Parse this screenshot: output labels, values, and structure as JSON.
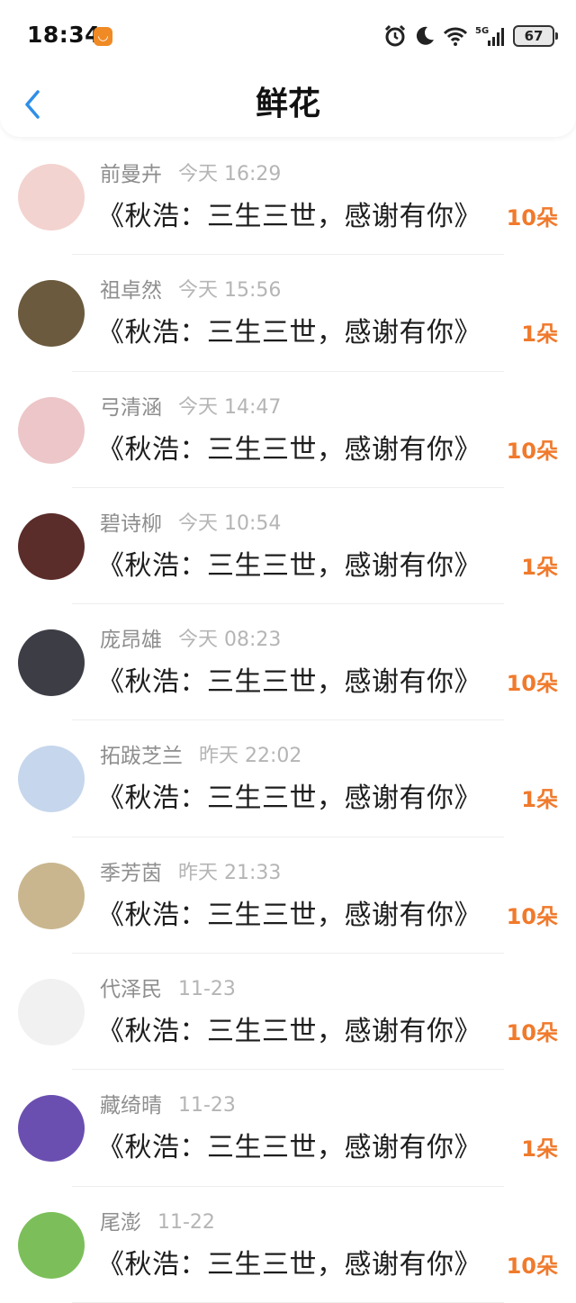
{
  "status_bar": {
    "time": "18:34",
    "battery": "67"
  },
  "header": {
    "title": "鲜花"
  },
  "items": [
    {
      "name": "前曼卉",
      "time": "今天 16:29",
      "gift": "《秋浩：三生三世，感谢有你》",
      "count": "10朵",
      "avatar_color": "#f3d3cf"
    },
    {
      "name": "祖卓然",
      "time": "今天 15:56",
      "gift": "《秋浩：三生三世，感谢有你》",
      "count": "1朵",
      "avatar_color": "#6b5a3e"
    },
    {
      "name": "弓清涵",
      "time": "今天 14:47",
      "gift": "《秋浩：三生三世，感谢有你》",
      "count": "10朵",
      "avatar_color": "#ecc6c8"
    },
    {
      "name": "碧诗柳",
      "time": "今天 10:54",
      "gift": "《秋浩：三生三世，感谢有你》",
      "count": "1朵",
      "avatar_color": "#5a2c2a"
    },
    {
      "name": "庞昂雄",
      "time": "今天 08:23",
      "gift": "《秋浩：三生三世，感谢有你》",
      "count": "10朵",
      "avatar_color": "#3c3d45"
    },
    {
      "name": "拓跋芝兰",
      "time": "昨天 22:02",
      "gift": "《秋浩：三生三世，感谢有你》",
      "count": "1朵",
      "avatar_color": "#c6d6ec"
    },
    {
      "name": "季芳茵",
      "time": "昨天 21:33",
      "gift": "《秋浩：三生三世，感谢有你》",
      "count": "10朵",
      "avatar_color": "#c9b68f"
    },
    {
      "name": "代泽民",
      "time": "11-23",
      "gift": "《秋浩：三生三世，感谢有你》",
      "count": "10朵",
      "avatar_color": "#f1f1f1"
    },
    {
      "name": "藏绮晴",
      "time": "11-23",
      "gift": "《秋浩：三生三世，感谢有你》",
      "count": "1朵",
      "avatar_color": "#6a4fb0"
    },
    {
      "name": "尾澎",
      "time": "11-22",
      "gift": "《秋浩：三生三世，感谢有你》",
      "count": "10朵",
      "avatar_color": "#7cbf5a"
    }
  ],
  "colors": {
    "accent_orange": "#f07a2c",
    "back_blue": "#2f8fe8"
  }
}
